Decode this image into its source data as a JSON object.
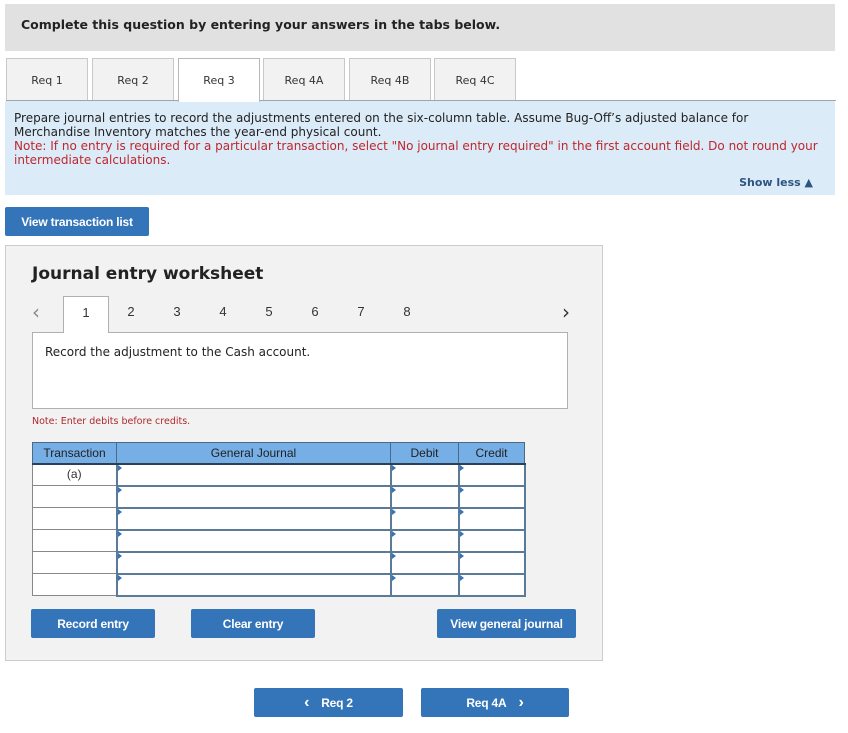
{
  "header": {
    "title": "Complete this question by entering your answers in the tabs below."
  },
  "tabs": [
    {
      "label": "Req 1",
      "active": false
    },
    {
      "label": "Req 2",
      "active": false
    },
    {
      "label": "Req 3",
      "active": true
    },
    {
      "label": "Req 4A",
      "active": false
    },
    {
      "label": "Req 4B",
      "active": false
    },
    {
      "label": "Req 4C",
      "active": false
    }
  ],
  "instructions": {
    "text": "Prepare journal entries to record the adjustments entered on the six-column table. Assume Bug-Off’s adjusted balance for Merchandise Inventory matches the year-end physical count.",
    "note": "Note: If no entry is required for a particular transaction, select \"No journal entry required\" in the first account field. Do not round your intermediate calculations.",
    "show_less": "Show less ▲"
  },
  "view_transaction_list": "View transaction list",
  "worksheet": {
    "title": "Journal entry worksheet",
    "pager": {
      "prev_icon": "‹",
      "next_icon": "›",
      "pages": [
        "1",
        "2",
        "3",
        "4",
        "5",
        "6",
        "7",
        "8"
      ],
      "current": "1"
    },
    "description": "Record the adjustment to the Cash account.",
    "note": "Note: Enter debits before credits.",
    "table": {
      "headers": {
        "transaction": "Transaction",
        "general_journal": "General Journal",
        "debit": "Debit",
        "credit": "Credit"
      },
      "rows": [
        {
          "transaction": "(a)",
          "account": "",
          "debit": "",
          "credit": ""
        },
        {
          "transaction": "",
          "account": "",
          "debit": "",
          "credit": ""
        },
        {
          "transaction": "",
          "account": "",
          "debit": "",
          "credit": ""
        },
        {
          "transaction": "",
          "account": "",
          "debit": "",
          "credit": ""
        },
        {
          "transaction": "",
          "account": "",
          "debit": "",
          "credit": ""
        },
        {
          "transaction": "",
          "account": "",
          "debit": "",
          "credit": ""
        }
      ]
    },
    "buttons": {
      "record": "Record entry",
      "clear": "Clear entry",
      "view_journal": "View general journal"
    }
  },
  "nav": {
    "prev_label": "Req 2",
    "prev_icon": "‹",
    "next_label": "Req 4A",
    "next_icon": "›"
  },
  "colors": {
    "accent": "#3474b8",
    "note_red": "#c0262c",
    "instructions_bg": "#dbebf8",
    "table_header": "#76aee6"
  }
}
